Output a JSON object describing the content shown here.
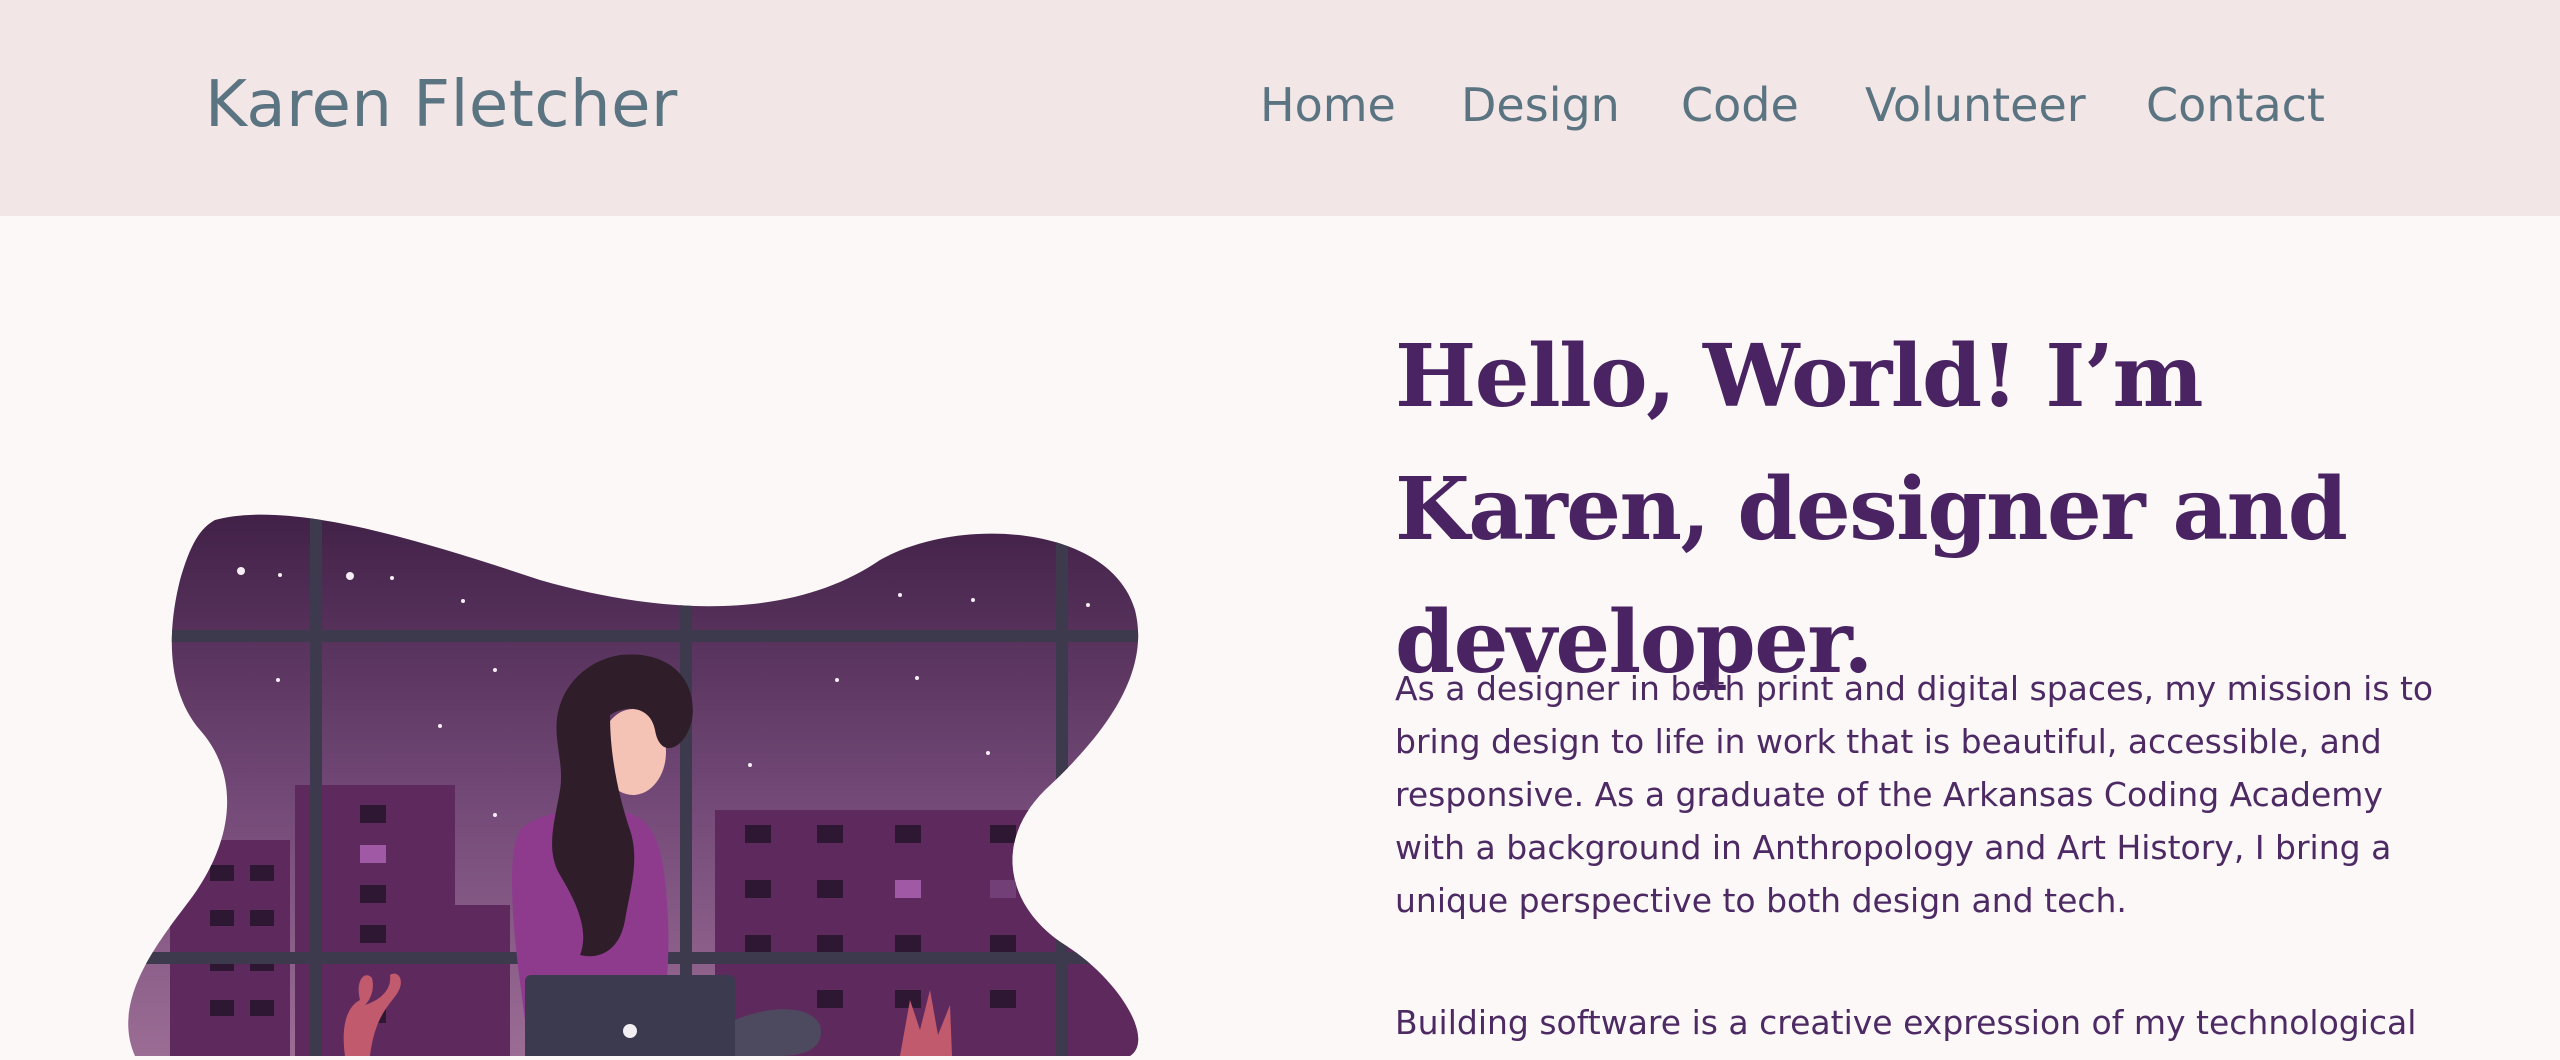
{
  "header": {
    "logo": "Karen Fletcher",
    "nav": [
      "Home",
      "Design",
      "Code",
      "Volunteer",
      "Contact"
    ]
  },
  "hero": {
    "headline": "Hello, World! I’m Karen, designer and developer.",
    "paragraphs": [
      "As a designer in both print and digital spaces, my mission is to bring design to life in work that is beautiful, accessible, and responsive. As a graduate of the Arkansas Coding Academy with a background in Anthropology and Art History, I bring a unique perspective to both design and tech.",
      "Building software is a creative expression of my technological"
    ]
  },
  "colors": {
    "header_bg": "#f3e6e6",
    "page_bg": "#fcf8f8",
    "nav_text": "#5b7482",
    "headline": "#4a2462",
    "body_text": "#4d2a63"
  },
  "icons": {
    "illustration": "woman-with-laptop-by-night-window"
  }
}
